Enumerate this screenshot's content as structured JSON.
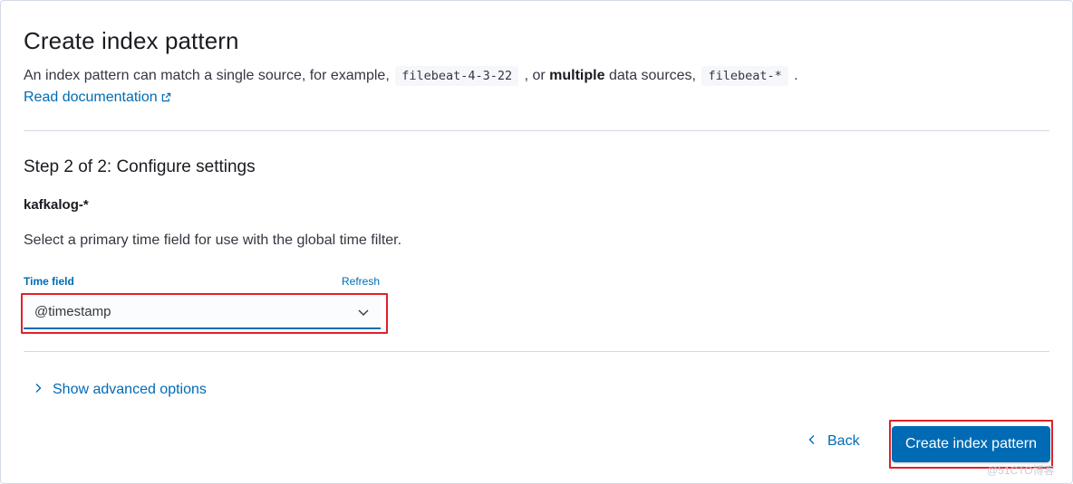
{
  "header": {
    "title": "Create index pattern",
    "description": {
      "part1": "An index pattern can match a single source, for example, ",
      "code1": "filebeat-4-3-22",
      "part2": " , or ",
      "bold": "multiple",
      "part3": " data sources, ",
      "code2": "filebeat-*",
      "part4": " ."
    },
    "doc_link_label": "Read documentation",
    "doc_link_icon": "external-link-icon"
  },
  "step": {
    "title": "Step 2 of 2: Configure settings",
    "pattern_name": "kafkalog-*",
    "hint": "Select a primary time field for use with the global time filter."
  },
  "time_field": {
    "label": "Time field",
    "refresh_label": "Refresh",
    "selected_value": "@timestamp",
    "dropdown_icon": "chevron-down-icon"
  },
  "advanced": {
    "toggle_label": "Show advanced options",
    "icon": "chevron-right-icon"
  },
  "footer": {
    "back_label": "Back",
    "back_icon": "chevron-left-icon",
    "create_label": "Create index pattern"
  },
  "watermark": "@51CTO博客",
  "colors": {
    "primary": "#006bb4",
    "highlight": "#e0202a",
    "border": "#d3dae6",
    "text": "#343741",
    "title": "#1a1c21"
  }
}
